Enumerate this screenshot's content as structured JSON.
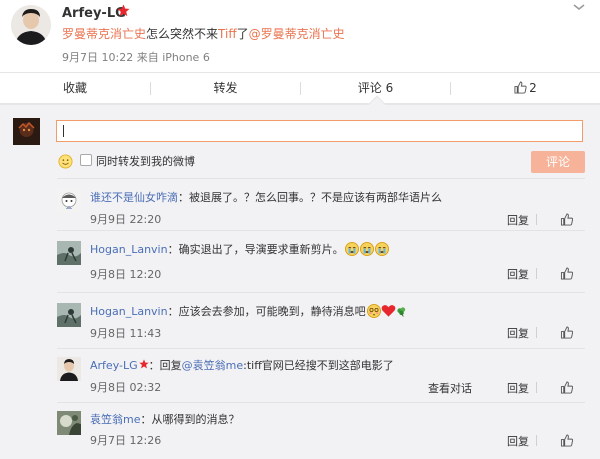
{
  "post": {
    "author": "Arfey-LG",
    "text_prefix_link": "罗曼蒂克消亡史",
    "text_middle": "怎么突然不来",
    "text_tiff": "Tiff",
    "text_le": "了",
    "text_mention": "@罗曼蒂克消亡史",
    "date": "9月7日 10:22",
    "source": "来自 iPhone 6"
  },
  "actions": {
    "favorite": "收藏",
    "repost": "转发",
    "comment": "评论 6",
    "like_count": "2"
  },
  "composer": {
    "repost_checkbox_label": "同时转发到我的微博",
    "submit_label": "评论"
  },
  "comments": [
    {
      "user": "谁还不是仙女咋滴",
      "sep": "：",
      "text": "被退展了。？怎么回事。？不是应该有两部华语片么",
      "time": "9月9日 22:20",
      "reply": "回复"
    },
    {
      "user": "Hogan_Lanvin",
      "sep": "：",
      "text": "确实退出了，导演要求重新剪片。",
      "time": "9月8日 12:20",
      "reply": "回复"
    },
    {
      "user": "Hogan_Lanvin",
      "sep": "：",
      "text": "应该会去参加，可能晚到，静待消息吧",
      "time": "9月8日 11:43",
      "reply": "回复"
    },
    {
      "user": "Arfey-LG",
      "sep": "：回复",
      "mention": "@袁笠翁me",
      "text": ":tiff官网已经搜不到这部电影了",
      "time": "9月8日 02:32",
      "reply": "回复",
      "see_conversation": "查看对话"
    },
    {
      "user": "袁笠翁me",
      "sep": "：",
      "text": "从哪得到的消息？",
      "time": "9月7日 12:26",
      "reply": "回复"
    }
  ],
  "colors": {
    "link_orange": "#eb7350",
    "user_blue": "#4a6eb5",
    "vip_red": "#e8262d",
    "submit_disabled": "#f7b39a",
    "panel_bg": "#f2f2f5"
  },
  "icons": [
    "chevron-down-icon",
    "thumbs-up-icon",
    "smile-icon",
    "crying-emoji-icon",
    "shy-emoji-icon",
    "heart-icon",
    "leaf-icon",
    "vip-star-icon"
  ]
}
